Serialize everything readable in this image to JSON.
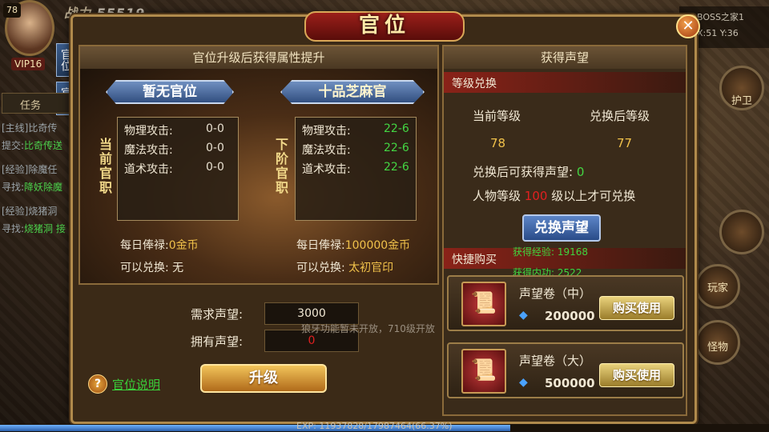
{
  "hud": {
    "level": "78",
    "zhanli_value": "55519",
    "vip": "VIP16",
    "side_tab_1": "官位",
    "side_tab_2": "官印",
    "task_header": "任务",
    "tasks": [
      {
        "tag": "[主线]",
        "text": "比奇传"
      },
      {
        "tag": "提交:",
        "text": "比奇传送"
      },
      {
        "tag": "[经验]",
        "text": "除魔任"
      },
      {
        "tag": "寻找:",
        "text": "降妖除魔"
      },
      {
        "tag": "[经验]",
        "text": "烧猪洞"
      },
      {
        "tag": "寻找:",
        "text": "烧猪洞 接"
      }
    ],
    "boss_text": "BOSS之家1",
    "coords": "X:51 Y:36",
    "guard_label": "护卫",
    "player_label": "玩家",
    "monster_label": "怪物",
    "exp_text": "EXP: 11937828/17987464(66.37%)",
    "exp_progress": 0.6637
  },
  "panel": {
    "title": "官位",
    "left": {
      "banner": "官位升级后获得属性提升",
      "current_label": "当前官职",
      "next_label": "下阶官职",
      "current_rank": "暂无官位",
      "next_rank": "十品芝麻官",
      "current_stats": [
        {
          "name": "物理攻击:",
          "value": "0-0"
        },
        {
          "name": "魔法攻击:",
          "value": "0-0"
        },
        {
          "name": "道术攻击:",
          "value": "0-0"
        }
      ],
      "next_stats": [
        {
          "name": "物理攻击:",
          "value": "22-6"
        },
        {
          "name": "魔法攻击:",
          "value": "22-6"
        },
        {
          "name": "道术攻击:",
          "value": "22-6"
        }
      ],
      "current_salary_label": "每日俸禄:",
      "current_salary": "0金币",
      "current_exchange_label": "可以兑换:",
      "current_exchange": "无",
      "next_salary_label": "每日俸禄:",
      "next_salary": "100000金币",
      "next_exchange_label": "可以兑换:",
      "next_exchange": "太初官印",
      "required_label": "需求声望:",
      "required_value": "3000",
      "owned_label": "拥有声望:",
      "owned_value": "0",
      "help_icon_text": "?",
      "help_link": "官位说明",
      "upgrade_button": "升级"
    },
    "right": {
      "banner": "获得声望",
      "level_exchange_bar": "等级兑换",
      "current_level_label": "当前等级",
      "current_level": "78",
      "after_level_label": "兑换后等级",
      "after_level": "77",
      "gain_label": "兑换后可获得声望:",
      "gain_value": "0",
      "req_prefix": "人物等级",
      "req_level": "100",
      "req_suffix": "级以上才可兑换",
      "exchange_button": "兑换声望",
      "float_exp": "获得经验: 19168",
      "float_neigong": "获得内功: 2522",
      "quick_buy_bar": "快捷购买",
      "items": [
        {
          "name": "声望卷（中）",
          "price": "200000",
          "button": "购买使用"
        },
        {
          "name": "声望卷（大）",
          "price": "500000",
          "button": "购买使用"
        }
      ]
    },
    "notice": "狼牙功能暂未开放，710级开放",
    "colors": {
      "title_red": "#9b1f1a",
      "gold": "#f0c14a",
      "green": "#43d643",
      "red": "#e02020"
    }
  }
}
